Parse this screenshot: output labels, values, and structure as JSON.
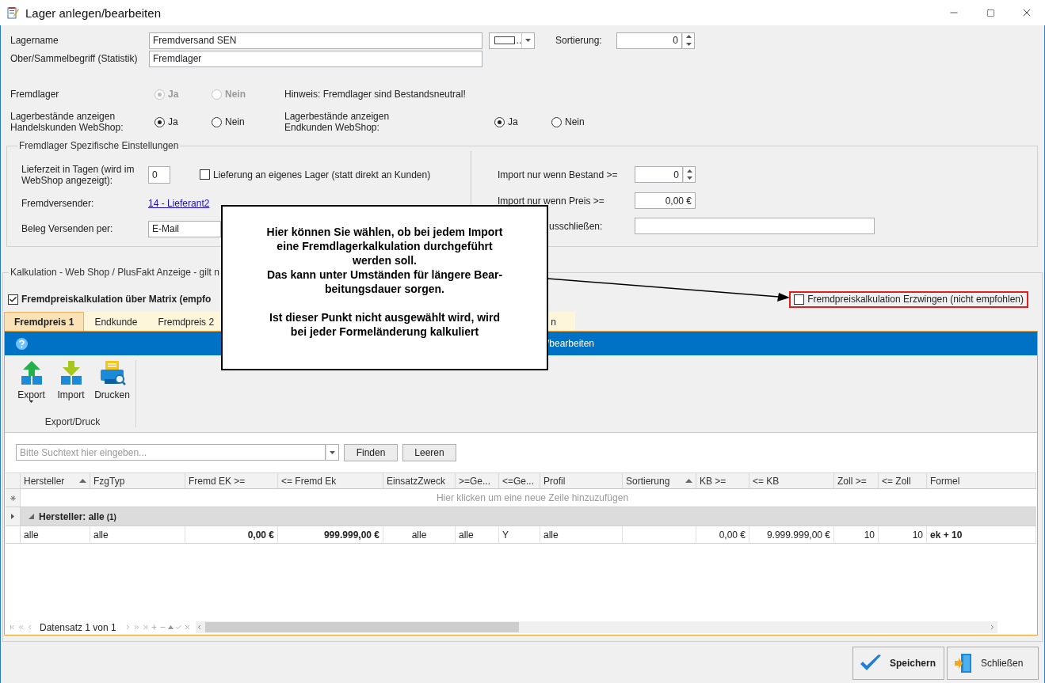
{
  "window": {
    "title": "Lager anlegen/bearbeiten"
  },
  "form": {
    "lagername": {
      "label": "Lagername",
      "value": "Fremdversand SEN"
    },
    "color_picker": {
      "label": ".."
    },
    "sortierung": {
      "label": "Sortierung:",
      "value": "0"
    },
    "oberbegriff": {
      "label": "Ober/Sammelbegriff (Statistik)",
      "value": "Fremdlager"
    }
  },
  "fremdlager": {
    "label": "Fremdlager",
    "disabled": true,
    "options": [
      {
        "label": "Ja",
        "selected": true
      },
      {
        "label": "Nein",
        "selected": false
      }
    ],
    "hint": "Hinweis: Fremdlager sind Bestandsneutral!"
  },
  "webshop_stock": [
    {
      "label": "Lagerbestände anzeigen\nHandelskunden WebShop:",
      "options": [
        {
          "label": "Ja",
          "selected": true
        },
        {
          "label": "Nein",
          "selected": false
        }
      ]
    },
    {
      "label": "Lagerbestände anzeigen\nEndkunden WebShop:",
      "options": [
        {
          "label": "Ja",
          "selected": true
        },
        {
          "label": "Nein",
          "selected": false
        }
      ]
    }
  ],
  "fremdlager_settings": {
    "title": "Fremdlager Spezifische Einstellungen",
    "lieferzeit": {
      "label": "Lieferzeit in Tagen (wird im\nWebShop angezeigt):",
      "value": "0"
    },
    "eigenes_lager": {
      "label": "Lieferung an eigenes Lager (statt direkt an Kunden)",
      "checked": false
    },
    "fremdversender": {
      "label": "Fremdversender:",
      "link": "14 - Lieferant2"
    },
    "beleg": {
      "label": "Beleg Versenden per:",
      "value": "E-Mail"
    },
    "import_bestand": {
      "label": "Import nur wenn Bestand >=",
      "value": "0"
    },
    "import_preis": {
      "label": "Import nur wenn Preis >=",
      "value": "0,00 €"
    },
    "ausschliessen": {
      "label": "usschließen:"
    }
  },
  "kalkulation": {
    "title": "Kalkulation - Web Shop / PlusFakt Anzeige - gilt n",
    "matrix": {
      "label": "Fremdpreiskalkulation über Matrix (empfo",
      "checked": true
    },
    "erzwingen": {
      "label": "Fremdpreiskalkulation Erzwingen (nicht empfohlen)",
      "checked": false
    },
    "tabs": [
      {
        "label": "Fremdpreis 1",
        "selected": true
      },
      {
        "label": "Endkunde",
        "selected": false
      },
      {
        "label": "Fremdpreis 2",
        "selected": false
      },
      {
        "label": "n",
        "selected": false
      }
    ],
    "panel_title": "/bearbeiten",
    "ribbon": {
      "buttons": [
        {
          "label": "Export",
          "kind": "export",
          "dropdown": true
        },
        {
          "label": "Import",
          "kind": "import",
          "dropdown": false
        },
        {
          "label": "Drucken",
          "kind": "print",
          "dropdown": false
        }
      ],
      "group": "Export/Druck"
    },
    "search": {
      "placeholder": "Bitte Suchtext hier eingeben...",
      "buttons": [
        "Finden",
        "Leeren"
      ]
    },
    "table": {
      "columns": [
        {
          "label": "Hersteller",
          "sorted": true
        },
        {
          "label": "FzgTyp",
          "sorted": false
        },
        {
          "label": "Fremd EK >=",
          "sorted": false
        },
        {
          "label": "<= Fremd Ek",
          "sorted": false
        },
        {
          "label": "EinsatzZweck",
          "sorted": false
        },
        {
          "label": ">=Ge...",
          "sorted": false
        },
        {
          "label": "<=Ge...",
          "sorted": false
        },
        {
          "label": "Profil",
          "sorted": false
        },
        {
          "label": "Sortierung",
          "sorted": true
        },
        {
          "label": "KB >=",
          "sorted": false
        },
        {
          "label": "<= KB",
          "sorted": false
        },
        {
          "label": "Zoll >=",
          "sorted": false
        },
        {
          "label": "<= Zoll",
          "sorted": false
        },
        {
          "label": "Formel",
          "sorted": false
        }
      ],
      "new_row_hint": "Hier klicken um eine neue Zeile hinzuzufügen",
      "group_row": {
        "label": "Hersteller: alle",
        "count": "(1)",
        "expanded": true,
        "current": true
      },
      "rows": [
        {
          "cells": [
            "alle",
            "alle",
            "0,00 €",
            "999.999,00 €",
            "alle",
            "alle",
            "Y",
            "alle",
            null,
            "0,00 €",
            "9.999.999,00 €",
            "10",
            "10",
            "ek + 10"
          ]
        }
      ]
    },
    "navigator": {
      "text": "Datensatz 1 von 1"
    }
  },
  "callout": {
    "text": "Hier können Sie wählen, ob bei jedem Import\neine Fremdlagerkalkulation durchgeführt\nwerden soll.\nDas kann unter Umständen für längere Bear-\nbeitungsdauer sorgen.\n\nIst dieser Punkt nicht ausgewählt wird, wird\nbei jeder Formeländerung kalkuliert"
  },
  "footer": {
    "buttons": [
      {
        "label": "Speichern",
        "kind": "save",
        "default": true
      },
      {
        "label": "Schließen",
        "kind": "close",
        "default": false
      }
    ]
  }
}
